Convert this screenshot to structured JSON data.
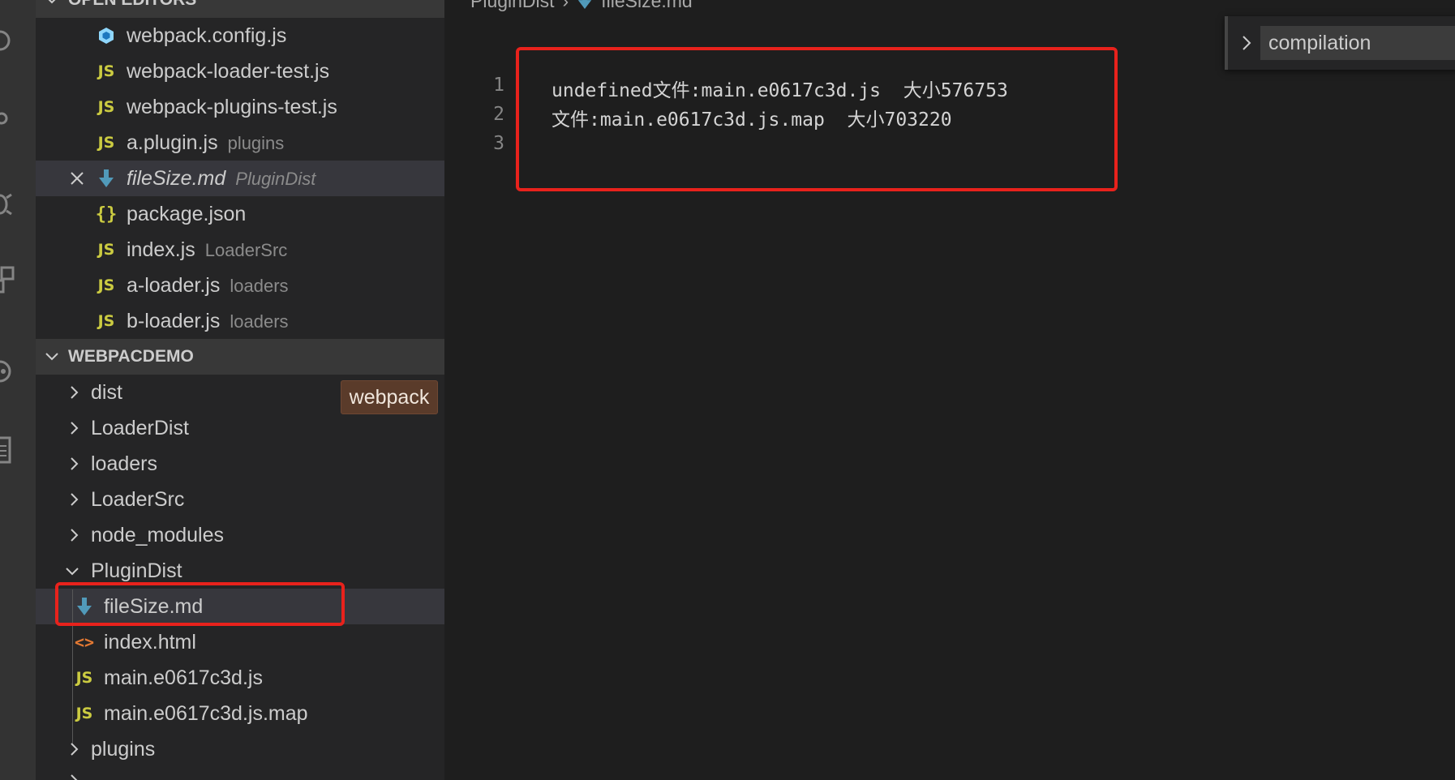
{
  "sidebar": {
    "open_editors_header": "OPEN EDITORS",
    "open_editors": [
      {
        "name": "webpack.config.js",
        "desc": "",
        "icon": "webpack-cube-icon"
      },
      {
        "name": "webpack-loader-test.js",
        "desc": "",
        "icon": "js-file-icon"
      },
      {
        "name": "webpack-plugins-test.js",
        "desc": "",
        "icon": "js-file-icon"
      },
      {
        "name": "a.plugin.js",
        "desc": "plugins",
        "icon": "js-file-icon"
      },
      {
        "name": "fileSize.md",
        "desc": "PluginDist",
        "icon": "markdown-file-icon"
      },
      {
        "name": "package.json",
        "desc": "",
        "icon": "json-file-icon"
      },
      {
        "name": "index.js",
        "desc": "LoaderSrc",
        "icon": "js-file-icon"
      },
      {
        "name": "a-loader.js",
        "desc": "loaders",
        "icon": "js-file-icon"
      },
      {
        "name": "b-loader.js",
        "desc": "loaders",
        "icon": "js-file-icon"
      }
    ],
    "workspace_header": "WEBPACDEMO",
    "tree": [
      {
        "name": "dist",
        "kind": "folder"
      },
      {
        "name": "LoaderDist",
        "kind": "folder"
      },
      {
        "name": "loaders",
        "kind": "folder"
      },
      {
        "name": "LoaderSrc",
        "kind": "folder"
      },
      {
        "name": "node_modules",
        "kind": "folder"
      },
      {
        "name": "PluginDist",
        "kind": "folder-open"
      },
      {
        "name": "fileSize.md",
        "kind": "file"
      },
      {
        "name": "index.html",
        "kind": "file"
      },
      {
        "name": "main.e0617c3d.js",
        "kind": "file"
      },
      {
        "name": "main.e0617c3d.js.map",
        "kind": "file"
      },
      {
        "name": "plugins",
        "kind": "folder"
      }
    ],
    "tooltip_badge": "webpack",
    "js_badge": "JS",
    "json_badge": "{}",
    "html_badge": "<>"
  },
  "editor": {
    "breadcrumb": [
      "PluginDist",
      "fileSize.md"
    ],
    "lines": [
      {
        "num": "1",
        "text": "undefined文件:main.e0617c3d.js  大小576753"
      },
      {
        "num": "2",
        "text": "文件:main.e0617c3d.js.map  大小703220"
      },
      {
        "num": "3",
        "text": ""
      }
    ],
    "find_value": "compilation"
  },
  "colors": {
    "highlight_box": "#e8221c",
    "js_icon": "#cbcb41",
    "md_icon": "#519aba",
    "html_icon": "#e37933"
  }
}
